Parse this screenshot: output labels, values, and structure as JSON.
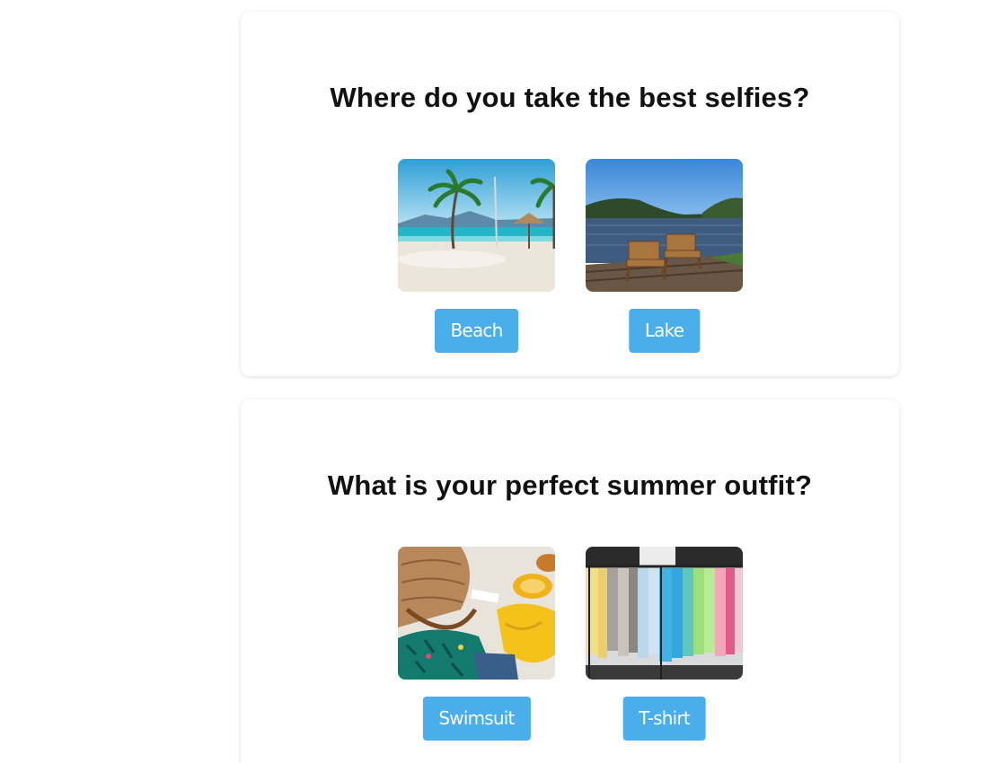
{
  "questions": [
    {
      "title": "Where do you take the best selfies?",
      "options": [
        {
          "label": "Beach",
          "image": "beach-photo"
        },
        {
          "label": "Lake",
          "image": "lake-photo"
        }
      ]
    },
    {
      "title": "What is your perfect summer outfit?",
      "options": [
        {
          "label": "Swimsuit",
          "image": "swimsuit-photo"
        },
        {
          "label": "T-shirt",
          "image": "tshirt-photo"
        }
      ]
    }
  ],
  "colors": {
    "button": "#4aaeea",
    "button_text": "#ffffff",
    "question_text": "#111111",
    "card": "#ffffff"
  }
}
